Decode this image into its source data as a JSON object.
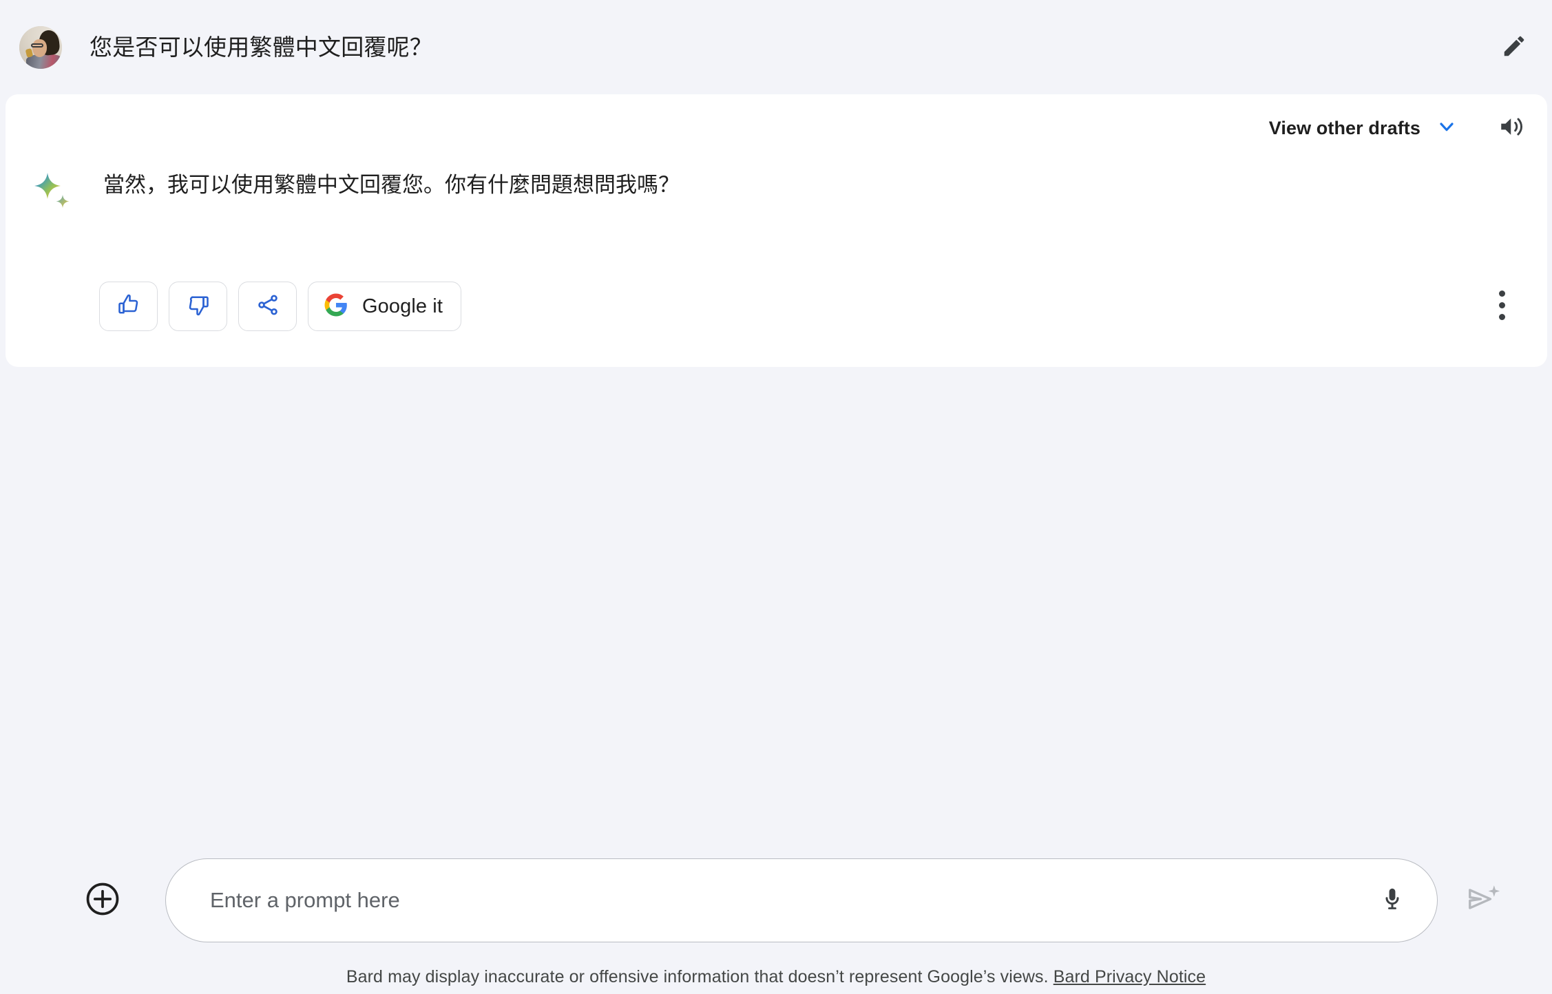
{
  "colors": {
    "page_background": "#f3f4f9",
    "card_background": "#ffffff",
    "accent_blue": "#1a73e8",
    "icon_dark": "#3c4043",
    "text_primary": "#1f1f1f",
    "text_secondary": "#5f6368",
    "border_grey": "#dadce0",
    "google_red": "#ea4335",
    "google_yellow": "#fbbc05",
    "google_green": "#34a853",
    "google_blue": "#4285f4"
  },
  "user_message": {
    "avatar_icon": "user-photo-avatar",
    "text": "您是否可以使用繁體中文回覆呢？",
    "edit_icon": "pencil-edit-icon"
  },
  "response": {
    "drafts_label": "View other drafts",
    "drafts_chevron_icon": "chevron-down-icon",
    "speaker_icon": "speaker-volume-icon",
    "bard_icon": "bard-sparkle-icon",
    "text": "當然，我可以使用繁體中文回覆您。你有什麼問題想問我嗎？",
    "actions": [
      {
        "id": "thumbs-up",
        "icon": "thumb-up-icon",
        "label": ""
      },
      {
        "id": "thumbs-down",
        "icon": "thumb-down-icon",
        "label": ""
      },
      {
        "id": "share",
        "icon": "share-icon",
        "label": ""
      }
    ],
    "google_it": {
      "icon": "google-g-icon",
      "label": "Google it"
    },
    "more_icon": "more-vertical-icon"
  },
  "composer": {
    "add_icon": "plus-circle-icon",
    "input_value": "",
    "input_placeholder": "Enter a prompt here",
    "mic_icon": "microphone-icon",
    "send_icon": "send-sparkle-icon"
  },
  "footer": {
    "disclaimer": "Bard may display inaccurate or offensive information that doesn’t represent Google’s views.",
    "privacy_link": "Bard Privacy Notice"
  }
}
